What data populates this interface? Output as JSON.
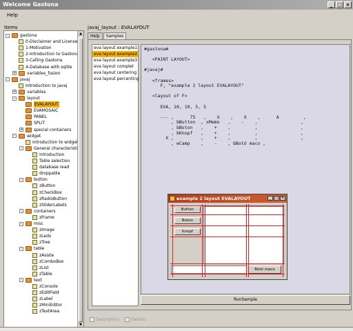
{
  "window": {
    "title": "Welcome Gastona",
    "minimize": "_",
    "maximize": "□",
    "close": "×"
  },
  "menu": {
    "help": "Help"
  },
  "left": {
    "label": "Items"
  },
  "tree": [
    {
      "label": "gastona",
      "type": "folder",
      "depth": 0,
      "expander": "-"
    },
    {
      "label": "0-Disclaimer and License",
      "type": "doc",
      "depth": 1
    },
    {
      "label": "1-Motivation",
      "type": "doc",
      "depth": 1
    },
    {
      "label": "2-Introduction to Gastona",
      "type": "doc",
      "depth": 1
    },
    {
      "label": "3-Calling Gastona",
      "type": "doc",
      "depth": 1
    },
    {
      "label": "4-Database with sqlite",
      "type": "doc",
      "depth": 1
    },
    {
      "label": "variables_fusion",
      "type": "folder",
      "depth": 1,
      "expander": "+"
    },
    {
      "label": "javaj",
      "type": "folder",
      "depth": 0,
      "expander": "-"
    },
    {
      "label": "Introduction to javaj",
      "type": "doc",
      "depth": 1
    },
    {
      "label": "variables",
      "type": "folder",
      "depth": 1,
      "expander": "+"
    },
    {
      "label": "layout",
      "type": "folder",
      "depth": 1,
      "expander": "-"
    },
    {
      "label": "EVALAYOUT",
      "type": "folder",
      "depth": 2,
      "selected": true
    },
    {
      "label": "EVAMOSAIC",
      "type": "folder",
      "depth": 2
    },
    {
      "label": "PANEL",
      "type": "folder",
      "depth": 2
    },
    {
      "label": "SPLIT",
      "type": "folder",
      "depth": 2
    },
    {
      "label": "special containers",
      "type": "folder",
      "depth": 2,
      "expander": "+"
    },
    {
      "label": "widget",
      "type": "folder",
      "depth": 1,
      "expander": "-"
    },
    {
      "label": "Introduction to widgets",
      "type": "doc",
      "depth": 2
    },
    {
      "label": "General characteristics",
      "type": "folder",
      "depth": 2,
      "expander": "-"
    },
    {
      "label": "Introduction",
      "type": "doc",
      "depth": 3
    },
    {
      "label": "Table selection",
      "type": "doc",
      "depth": 3
    },
    {
      "label": "database read",
      "type": "doc",
      "depth": 3
    },
    {
      "label": "droppable",
      "type": "doc",
      "depth": 3
    },
    {
      "label": "button",
      "type": "folder",
      "depth": 2,
      "expander": "-"
    },
    {
      "label": "zButton",
      "type": "doc",
      "depth": 3
    },
    {
      "label": "zCheckBox",
      "type": "doc",
      "depth": 3
    },
    {
      "label": "zRadioButton",
      "type": "doc",
      "depth": 3
    },
    {
      "label": "zSliderLabels",
      "type": "doc",
      "depth": 3
    },
    {
      "label": "containers",
      "type": "folder",
      "depth": 2,
      "expander": "-"
    },
    {
      "label": "zFrame",
      "type": "doc",
      "depth": 3
    },
    {
      "label": "misc",
      "type": "folder",
      "depth": 2,
      "expander": "-"
    },
    {
      "label": "zImage",
      "type": "doc",
      "depth": 3
    },
    {
      "label": "zLeds",
      "type": "doc",
      "depth": 3
    },
    {
      "label": "zTree",
      "type": "doc",
      "depth": 3
    },
    {
      "label": "table",
      "type": "folder",
      "depth": 2,
      "expander": "-"
    },
    {
      "label": "zAsiste",
      "type": "doc",
      "depth": 3
    },
    {
      "label": "zComboBox",
      "type": "doc",
      "depth": 3
    },
    {
      "label": "zList",
      "type": "doc",
      "depth": 3
    },
    {
      "label": "zTable",
      "type": "doc",
      "depth": 3
    },
    {
      "label": "text",
      "type": "folder",
      "depth": 2,
      "expander": "-"
    },
    {
      "label": "zConsole",
      "type": "doc",
      "depth": 3
    },
    {
      "label": "zEditField",
      "type": "doc",
      "depth": 3
    },
    {
      "label": "zLabel",
      "type": "doc",
      "depth": 3
    },
    {
      "label": "zMiniEditor",
      "type": "doc",
      "depth": 3
    },
    {
      "label": "zTextArea",
      "type": "doc",
      "depth": 3
    }
  ],
  "right": {
    "path_label": "javaj_layout : EVALAYOUT",
    "tabs": [
      "Help",
      "Samples"
    ],
    "active_tab": "Samples"
  },
  "examples": [
    {
      "label": "eva layout example1"
    },
    {
      "label": "eva layout example2",
      "selected": true
    },
    {
      "label": "eva layout example3"
    },
    {
      "label": "eva layout complet"
    },
    {
      "label": "eva layout centering"
    },
    {
      "label": "eva layout percenting"
    }
  ],
  "code": "#gastona#\n\n   <PAINT LAYOUT>\n\n#javaj#\n\n   <frames>\n      F, \"example 2 layout EVALAYOUT\"\n\n   <layout of F>\n\n      EVA, 10, 10, 5, 5\n\n      --- ,      75   ,    X    ,    X    ,      A         ,\n          , bButton  , xMemo   ,    -    ,                ,\n          , bBoton   ,    +    ,         ,                ,\n          , bKnopf   ,    +    ,         ,                ,\n        X ,          ,    +    ,         ,                ,\n          , eCamp    ,    -    , bBotó maco ,",
  "run_button": "RunSample",
  "options": {
    "description": "Description",
    "details": "Details"
  },
  "dialog": {
    "title": "example 2 layout EVALAYOUT",
    "buttons": [
      "Button",
      "Boton",
      "Knopf"
    ],
    "maco_button": "Botó maco",
    "win_minimize": "_",
    "win_maximize": "□",
    "win_close": "×"
  },
  "colors": {
    "selection": "#f5b000",
    "layout_lines": "#e02020",
    "code_bg": "#dad8e4"
  }
}
